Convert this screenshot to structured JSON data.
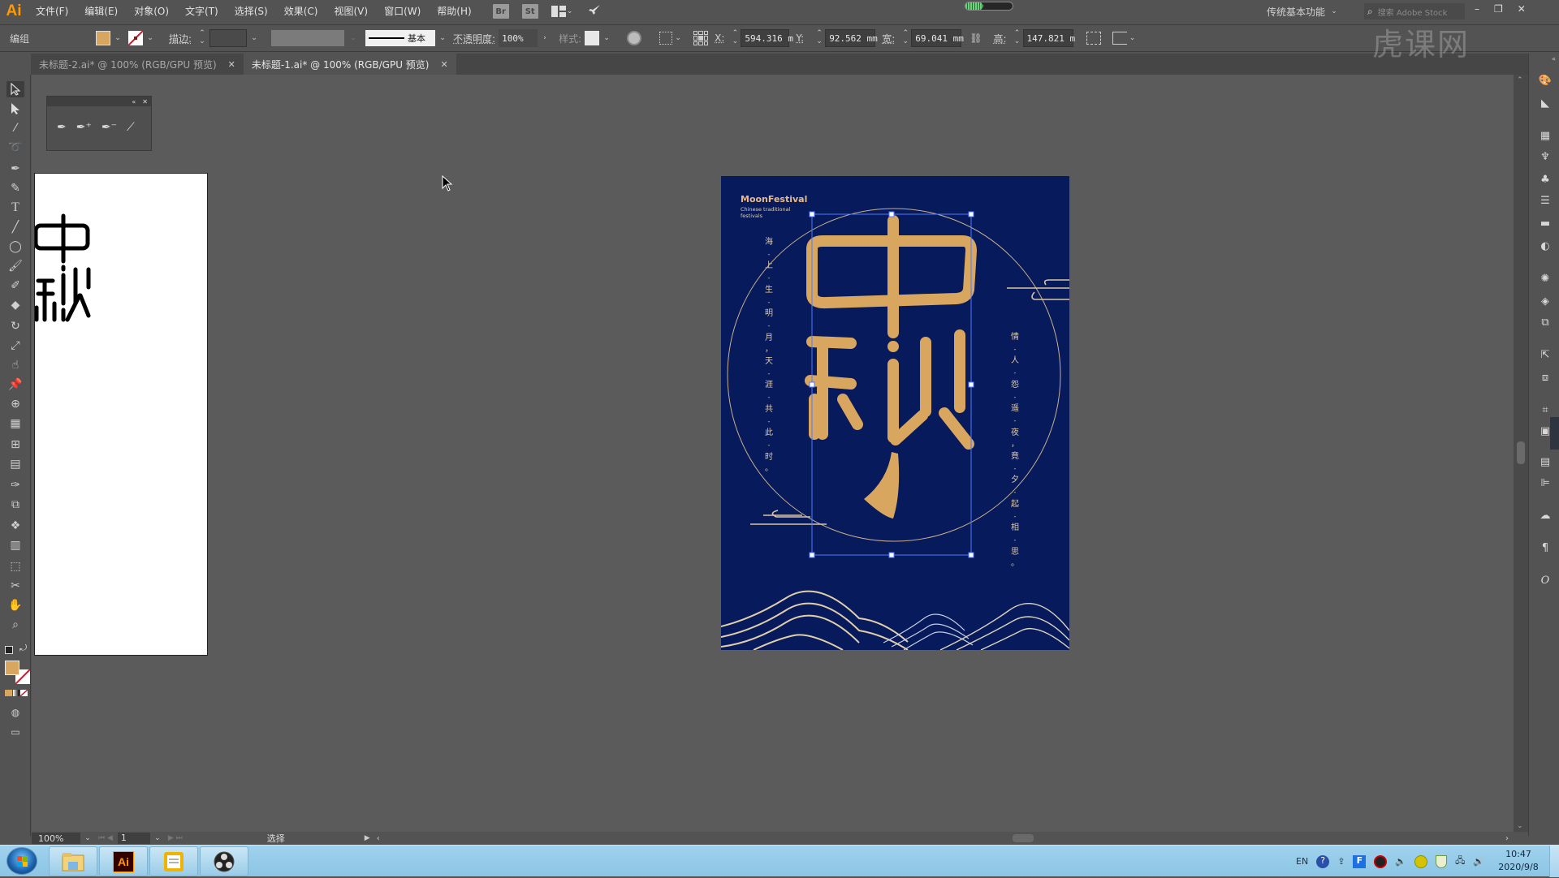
{
  "app": {
    "logo": "Ai",
    "name": "Adobe Illustrator"
  },
  "menubar": {
    "items": [
      "文件(F)",
      "编辑(E)",
      "对象(O)",
      "文字(T)",
      "选择(S)",
      "效果(C)",
      "视图(V)",
      "窗口(W)",
      "帮助(H)"
    ],
    "bridge_label": "Br",
    "stock_label": "St",
    "workspace": "传统基本功能",
    "search_placeholder": "搜索 Adobe Stock",
    "window_controls": {
      "minimize": "–",
      "restore": "❐",
      "close": "✕"
    }
  },
  "control_bar": {
    "selection_type": "编组",
    "fill_color": "#d9a660",
    "stroke_label": "描边:",
    "stroke_weight": "",
    "brush_label": "基本",
    "opacity_label": "不透明度:",
    "opacity_value": "100%",
    "style_label": "样式:",
    "x_label": "X:",
    "x_value": "594.316 m",
    "y_label": "Y:",
    "y_value": "92.562 mm",
    "w_label": "宽:",
    "w_value": "69.041 mm",
    "h_label": "高:",
    "h_value": "147.821 m"
  },
  "tabs": [
    {
      "label": "未标题-2.ai* @ 100% (RGB/GPU 预览)",
      "active": false
    },
    {
      "label": "未标题-1.ai* @ 100% (RGB/GPU 预览)",
      "active": true
    }
  ],
  "pen_panel": {
    "tools": [
      "pen-tool",
      "add-anchor-point-tool",
      "delete-anchor-point-tool",
      "anchor-point-tool"
    ]
  },
  "left_artboard": {
    "text": "中秋"
  },
  "poster": {
    "background": "#061a5c",
    "accent": "#d9a660",
    "brand": "MoonFestival",
    "subtitle_line1": "Chinese traditional",
    "subtitle_line2": "festivals",
    "title": "中秋",
    "poem_left": [
      "海",
      "-",
      "上",
      "-",
      "生",
      "-",
      "明",
      "-",
      "月",
      "，",
      "天",
      "-",
      "涯",
      "-",
      "共",
      "-",
      "此",
      "-",
      "时",
      "。"
    ],
    "poem_right": [
      "情",
      "-",
      "人",
      "-",
      "怨",
      "-",
      "遥",
      "-",
      "夜",
      "，",
      "竟",
      "-",
      "夕",
      "-",
      "起",
      "-",
      "相",
      "-",
      "思",
      "。"
    ]
  },
  "statusbar": {
    "zoom": "100%",
    "page": "1",
    "tool": "选择"
  },
  "taskbar": {
    "apps": [
      "windows-explorer",
      "adobe-illustrator",
      "notepad",
      "obs-studio"
    ],
    "ai_label": "Ai",
    "tray_lang": "EN",
    "time": "10:47",
    "date": "2020/9/8"
  },
  "watermark": "虎课网"
}
